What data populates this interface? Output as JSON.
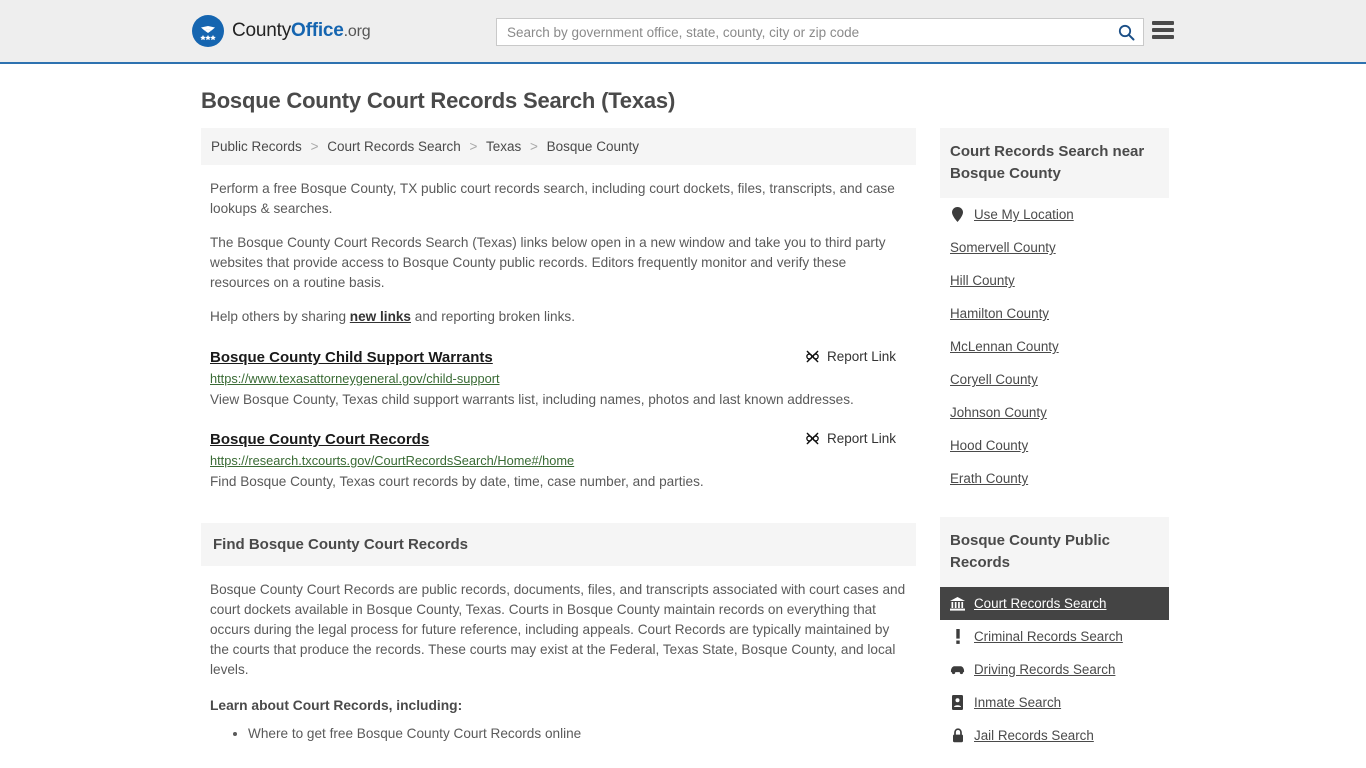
{
  "header": {
    "brand": {
      "part1": "County",
      "part2": "Office",
      "part3": ".org"
    },
    "search": {
      "placeholder": "Search by government office, state, county, city or zip code",
      "value": ""
    }
  },
  "page": {
    "title": "Bosque County Court Records Search (Texas)"
  },
  "breadcrumb": {
    "items": [
      "Public Records",
      "Court Records Search",
      "Texas",
      "Bosque County"
    ],
    "separator": ">"
  },
  "intro": {
    "p1": "Perform a free Bosque County, TX public court records search, including court dockets, files, transcripts, and case lookups & searches.",
    "p2": "The Bosque County Court Records Search (Texas) links below open in a new window and take you to third party websites that provide access to Bosque County public records. Editors frequently monitor and verify these resources on a routine basis.",
    "p3_before": "Help others by sharing ",
    "p3_link": "new links",
    "p3_after": " and reporting broken links."
  },
  "results": {
    "report_label": "Report Link",
    "items": [
      {
        "title": "Bosque County Child Support Warrants",
        "url": "https://www.texasattorneygeneral.gov/child-support",
        "description": "View Bosque County, Texas child support warrants list, including names, photos and last known addresses."
      },
      {
        "title": "Bosque County Court Records",
        "url": "https://research.txcourts.gov/CourtRecordsSearch/Home#/home",
        "description": "Find Bosque County, Texas court records by date, time, case number, and parties."
      }
    ]
  },
  "section": {
    "heading": "Find Bosque County Court Records",
    "body": "Bosque County Court Records are public records, documents, files, and transcripts associated with court cases and court dockets available in Bosque County, Texas. Courts in Bosque County maintain records on everything that occurs during the legal process for future reference, including appeals. Court Records are typically maintained by the courts that produce the records. These courts may exist at the Federal, Texas State, Bosque County, and local levels.",
    "learn_heading": "Learn about Court Records, including:",
    "bullets": [
      "Where to get free Bosque County Court Records online"
    ]
  },
  "sidebar": {
    "nearby": {
      "heading": "Court Records Search near Bosque County",
      "items": [
        {
          "label": "Use My Location",
          "icon": "map-pin-icon"
        },
        {
          "label": "Somervell County",
          "icon": ""
        },
        {
          "label": "Hill County",
          "icon": ""
        },
        {
          "label": "Hamilton County",
          "icon": ""
        },
        {
          "label": "McLennan County",
          "icon": ""
        },
        {
          "label": "Coryell County",
          "icon": ""
        },
        {
          "label": "Johnson County",
          "icon": ""
        },
        {
          "label": "Hood County",
          "icon": ""
        },
        {
          "label": "Erath County",
          "icon": ""
        }
      ]
    },
    "public_records": {
      "heading": "Bosque County Public Records",
      "items": [
        {
          "label": "Court Records Search",
          "icon": "courthouse-icon",
          "active": true
        },
        {
          "label": "Criminal Records Search",
          "icon": "exclamation-icon",
          "active": false
        },
        {
          "label": "Driving Records Search",
          "icon": "car-icon",
          "active": false
        },
        {
          "label": "Inmate Search",
          "icon": "id-badge-icon",
          "active": false
        },
        {
          "label": "Jail Records Search",
          "icon": "lock-icon",
          "active": false
        }
      ]
    }
  },
  "colors": {
    "brand_blue": "#1565b0",
    "header_bg": "#eeeeee",
    "header_border": "#2e72b0",
    "panel_bg": "#f5f5f5",
    "active_bg": "#444444",
    "url_green": "#3a6b35",
    "text_gray": "#5a5a5a"
  }
}
